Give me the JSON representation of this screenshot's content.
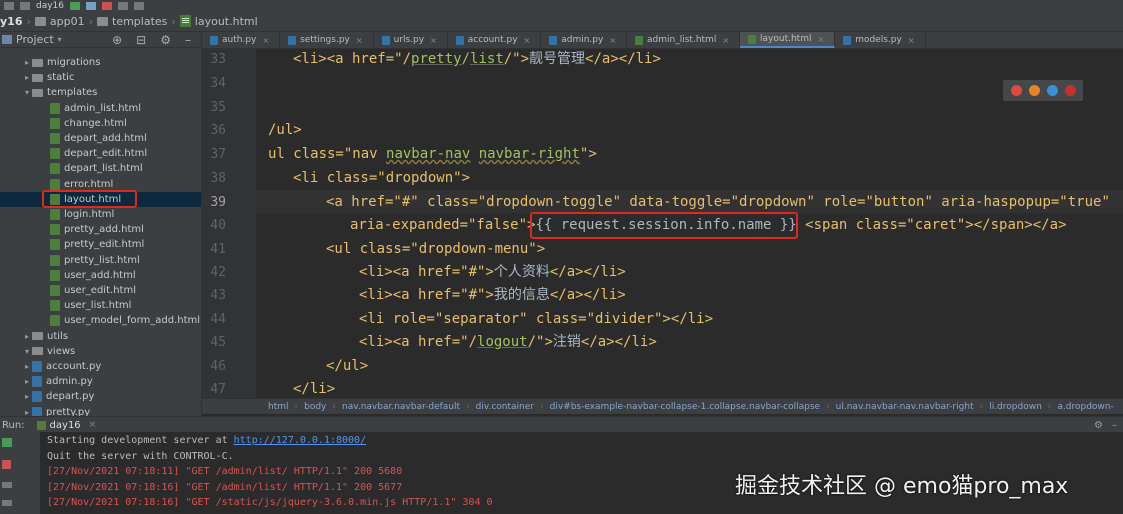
{
  "toolbar": {
    "run_config": "day16"
  },
  "breadcrumb": [
    "y16",
    "app01",
    "templates",
    "layout.html"
  ],
  "project": {
    "header": "Project",
    "tree": [
      {
        "label": "migrations",
        "kind": "dir",
        "depth": 1,
        "arrow": "▸"
      },
      {
        "label": "static",
        "kind": "dir",
        "depth": 1,
        "arrow": "▸"
      },
      {
        "label": "templates",
        "kind": "dir",
        "depth": 1,
        "arrow": "▾"
      },
      {
        "label": "admin_list.html",
        "kind": "html",
        "depth": 2
      },
      {
        "label": "change.html",
        "kind": "html",
        "depth": 2
      },
      {
        "label": "depart_add.html",
        "kind": "html",
        "depth": 2
      },
      {
        "label": "depart_edit.html",
        "kind": "html",
        "depth": 2
      },
      {
        "label": "depart_list.html",
        "kind": "html",
        "depth": 2
      },
      {
        "label": "error.html",
        "kind": "html",
        "depth": 2
      },
      {
        "label": "layout.html",
        "kind": "html",
        "depth": 2,
        "selected": true
      },
      {
        "label": "login.html",
        "kind": "html",
        "depth": 2
      },
      {
        "label": "pretty_add.html",
        "kind": "html",
        "depth": 2
      },
      {
        "label": "pretty_edit.html",
        "kind": "html",
        "depth": 2
      },
      {
        "label": "pretty_list.html",
        "kind": "html",
        "depth": 2
      },
      {
        "label": "user_add.html",
        "kind": "html",
        "depth": 2
      },
      {
        "label": "user_edit.html",
        "kind": "html",
        "depth": 2
      },
      {
        "label": "user_list.html",
        "kind": "html",
        "depth": 2
      },
      {
        "label": "user_model_form_add.html",
        "kind": "html",
        "depth": 2
      },
      {
        "label": "utils",
        "kind": "dir",
        "depth": 0,
        "arrow": "▸"
      },
      {
        "label": "views",
        "kind": "dir",
        "depth": 0,
        "arrow": "▾"
      },
      {
        "label": "account.py",
        "kind": "py",
        "depth": 1,
        "arrow": "▸"
      },
      {
        "label": "admin.py",
        "kind": "py",
        "depth": 1,
        "arrow": "▸"
      },
      {
        "label": "depart.py",
        "kind": "py",
        "depth": 1,
        "arrow": "▸"
      },
      {
        "label": "pretty.py",
        "kind": "py",
        "depth": 1,
        "arrow": "▸"
      }
    ]
  },
  "tabs": [
    {
      "label": "auth.py",
      "kind": "py"
    },
    {
      "label": "settings.py",
      "kind": "py"
    },
    {
      "label": "urls.py",
      "kind": "py"
    },
    {
      "label": "account.py",
      "kind": "py"
    },
    {
      "label": "admin.py",
      "kind": "py"
    },
    {
      "label": "admin_list.html",
      "kind": "html"
    },
    {
      "label": "layout.html",
      "kind": "html",
      "active": true
    },
    {
      "label": "models.py",
      "kind": "py"
    }
  ],
  "line_numbers": [
    "33",
    "34",
    "35",
    "36",
    "37",
    "38",
    "39",
    "40",
    "41",
    "42",
    "43",
    "44",
    "45",
    "46",
    "47"
  ],
  "current_line": "39",
  "code": {
    "l33_a": "<li><a href=\"/",
    "l33_b": "pretty",
    "l33_c": "/",
    "l33_d": "list",
    "l33_e": "/\">",
    "l33_f": "靓号管理",
    "l33_g": "</a></li>",
    "l36": "/ul>",
    "l37_a": "ul class=\"nav ",
    "l37_b": "navbar-nav",
    "l37_c": " ",
    "l37_d": "navbar-right",
    "l37_e": "\">",
    "l38": "<li class=\"dropdown\">",
    "l39_a": "<a",
    "l39_b": " href=\"#\" class=\"dropdown-toggle\" data-toggle=\"dropdown\" role=\"button\" aria-haspopup=\"true\"",
    "l40_a": "aria-expanded=\"false\">",
    "l40_b": "{{ request.session.info.name }}",
    "l40_c": " <span class=\"caret\"></span></a>",
    "l41": "<ul class=\"dropdown-menu\">",
    "l42_a": "<li><a href=\"#\">",
    "l42_b": "个人资料",
    "l42_c": "</a></li>",
    "l43_a": "<li><a href=\"#\">",
    "l43_b": "我的信息",
    "l43_c": "</a></li>",
    "l44": "<li role=\"separator\" class=\"divider\"></li>",
    "l45_a": "<li><a href=\"/",
    "l45_b": "logout",
    "l45_c": "/\">",
    "l45_d": "注销",
    "l45_e": "</a></li>",
    "l46": "</ul>",
    "l47": "</li>"
  },
  "status_crumbs": [
    "html",
    "body",
    "nav.navbar.navbar-default",
    "div.container",
    "div#bs-example-navbar-collapse-1.collapse.navbar-collapse",
    "ul.nav.navbar-nav.navbar-right",
    "li.dropdown",
    "a.dropdown-"
  ],
  "run": {
    "label": "Run:",
    "tab": "day16",
    "lines": [
      {
        "pre": "Starting development server at ",
        "link": "http://127.0.0.1:8000/",
        "color": "#bbbbbb"
      },
      {
        "pre": "Quit the server with CONTROL-C.",
        "color": "#bbbbbb"
      },
      {
        "pre": "[27/Nov/2021 07:18:11] \"GET /admin/list/ HTTP/1.1\" 200 5680",
        "color": "#d9534f"
      },
      {
        "pre": "[27/Nov/2021 07:18:16] \"GET /admin/list/ HTTP/1.1\" 200 5677",
        "color": "#d9534f"
      },
      {
        "pre": "[27/Nov/2021 07:18:16] \"GET /static/js/jquery-3.6.0.min.js HTTP/1.1\" 304 0",
        "color": "#d9534f"
      }
    ]
  },
  "watermark": "掘金技术社区 @ emo猫pro_max",
  "colors": {
    "accent": "#4a88c7",
    "highlight_border": "#e0281e",
    "tag": "#e8bf6a",
    "string": "#a5c25c"
  }
}
